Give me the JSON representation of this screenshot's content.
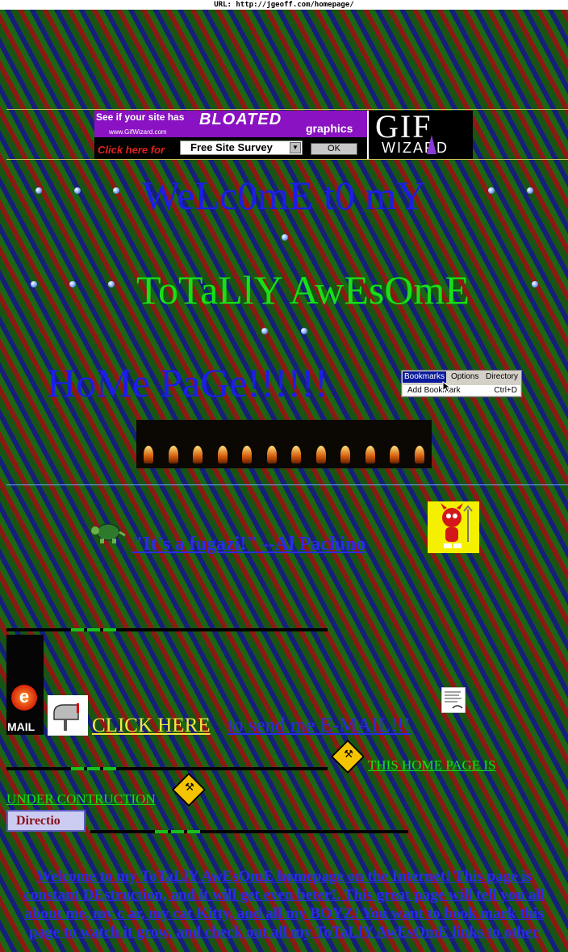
{
  "url_bar": {
    "label": "URL: http://jgeoff.com/homepage/"
  },
  "ad_banner": {
    "headline": "See if your site has",
    "highlight": "BLOATED",
    "suffix": "graphics",
    "site": "www.GifWizard.com",
    "cta": "Click here for",
    "select_value": "Free Site Survey",
    "ok_label": "OK",
    "logo_top": "GIF",
    "logo_bottom": "WIZARD"
  },
  "titles": {
    "line1": "WeLc0mE t0 mY",
    "line2": "ToTaLlY AwEsOmE",
    "line3": "HoMe PaGe!!!!!!"
  },
  "browser_menu": {
    "items": [
      "Bookmarks",
      "Options",
      "Directory"
    ],
    "dropdown_label": "Add Bookmark",
    "dropdown_shortcut": "Ctrl+D"
  },
  "quote": {
    "text": "\"It's a fugazi!\" --Al Pachino"
  },
  "email": {
    "gif_label": "MAIL",
    "gif_letter": "e",
    "click_here": "CLICK HERE",
    "send": "to send me E-MAIL!!!"
  },
  "construction": {
    "notice_line1": "THIS HOME PAGE IS",
    "notice_line2": "UNDER CONTRUCTION"
  },
  "directory_button": {
    "label": "Directio"
  },
  "welcome_paragraph": {
    "text": "Welcome to my ToTaLlY AwEsOmE homepage on the Internet! This page is constant DEstruction, and it will get even beter!. This great page will tell you all about me, my c ar, my cat Kitty, and all my BOYZ! You want to book mark this page to watch it grow, and check out all my ToTaLlY AwEsOmE links to other"
  },
  "colors": {
    "title_blue": "#1d1dea",
    "title_green": "#17e016",
    "link_blue": "#2b2be8",
    "click_yellow": "#f2e640"
  },
  "icons": [
    "turtle-icon",
    "devil-icon",
    "mailbox-icon",
    "email-animation-icon",
    "construction-icon",
    "paper-note-icon"
  ]
}
